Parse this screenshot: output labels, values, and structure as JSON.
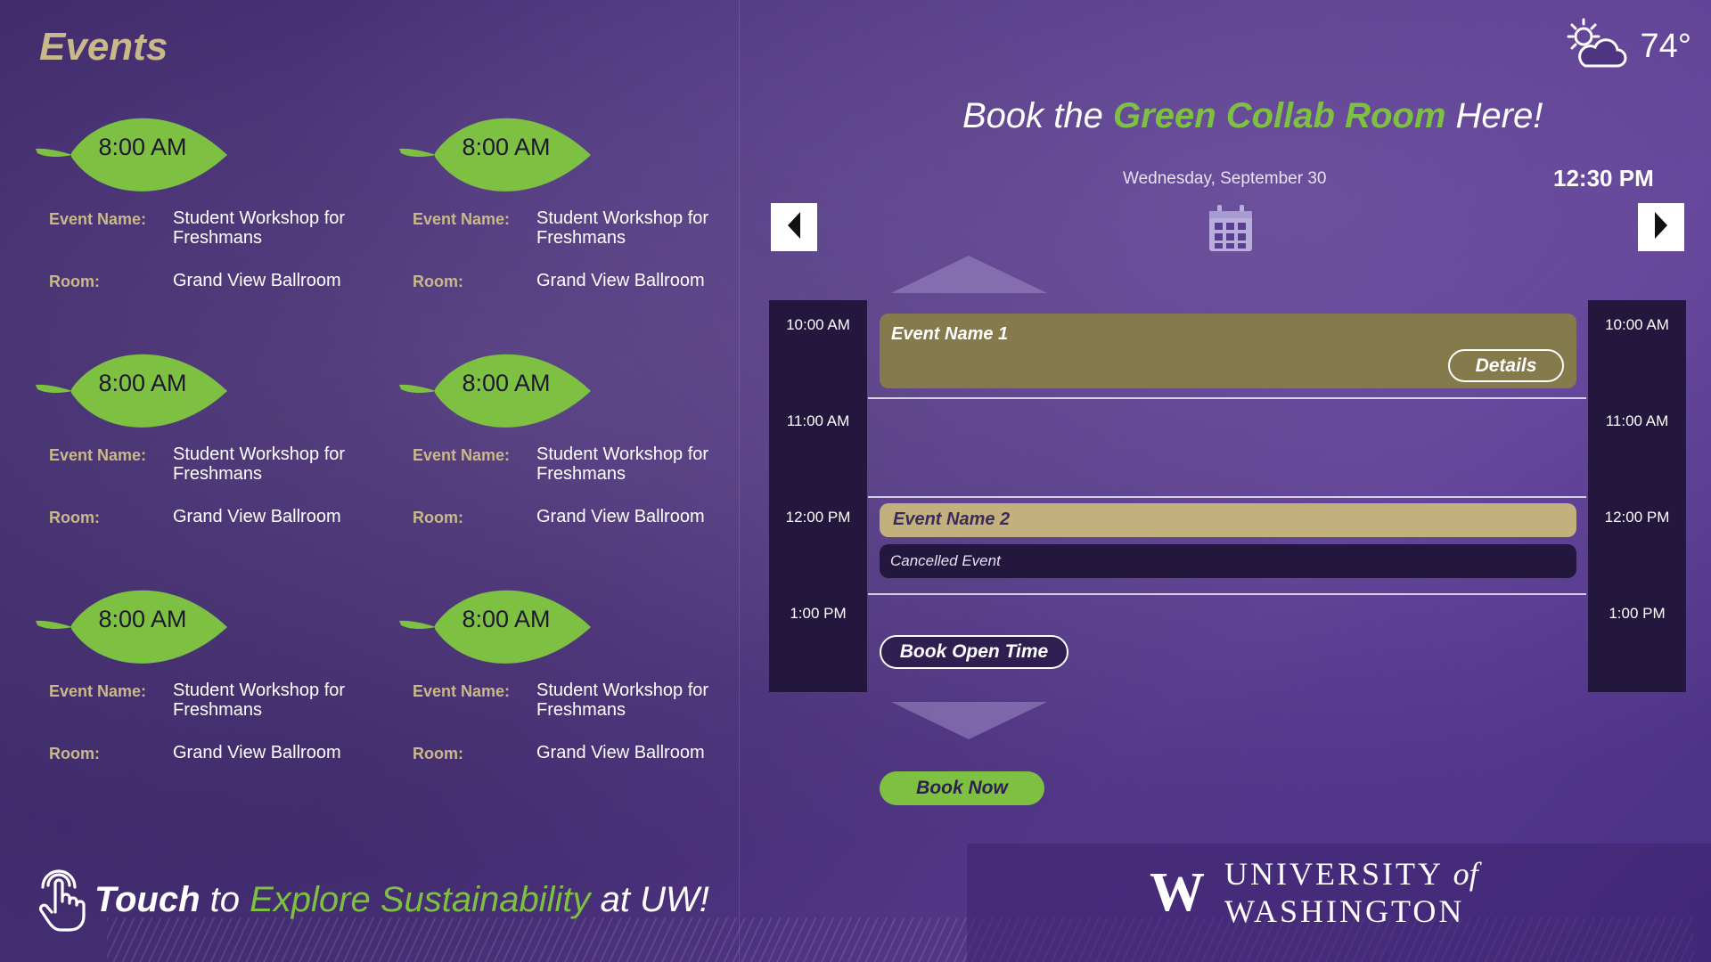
{
  "left_panel": {
    "title": "Events",
    "events": [
      {
        "time": "8:00 AM",
        "name_label": "Event Name:",
        "name": "Student Workshop for Freshmans",
        "room_label": "Room:",
        "room": "Grand View Ballroom"
      },
      {
        "time": "8:00 AM",
        "name_label": "Event Name:",
        "name": "Student Workshop for Freshmans",
        "room_label": "Room:",
        "room": "Grand View Ballroom"
      },
      {
        "time": "8:00 AM",
        "name_label": "Event Name:",
        "name": "Student Workshop for Freshmans",
        "room_label": "Room:",
        "room": "Grand View Ballroom"
      },
      {
        "time": "8:00 AM",
        "name_label": "Event Name:",
        "name": "Student Workshop for Freshmans",
        "room_label": "Room:",
        "room": "Grand View Ballroom"
      },
      {
        "time": "8:00 AM",
        "name_label": "Event Name:",
        "name": "Student Workshop for Freshmans",
        "room_label": "Room:",
        "room": "Grand View Ballroom"
      },
      {
        "time": "8:00 AM",
        "name_label": "Event Name:",
        "name": "Student Workshop for Freshmans",
        "room_label": "Room:",
        "room": "Grand View Ballroom"
      }
    ],
    "footer": {
      "touch": "Touch",
      "to": " to ",
      "explore": "Explore Sustainability",
      "at": " at UW!"
    }
  },
  "right_panel": {
    "weather": {
      "icon": "partly-cloudy-icon",
      "temperature": "74°"
    },
    "heading": {
      "prefix": "Book the ",
      "room": "Green Collab Room",
      "suffix": " Here!"
    },
    "date": "Wednesday, September 30",
    "current_time": "12:30 PM",
    "time_slots_left": [
      "10:00 AM",
      "11:00 AM",
      "12:00 PM",
      "1:00 PM"
    ],
    "time_slots_right": [
      "10:00 AM",
      "11:00 AM",
      "12:00 PM",
      "1:00 PM"
    ],
    "bookings": [
      {
        "name": "Event Name 1",
        "button": "Details"
      },
      {
        "name": "Event Name 2",
        "status": "Cancelled Event"
      }
    ],
    "open_time_button": "Book Open Time",
    "book_now_button": "Book Now",
    "logo": {
      "mark": "W",
      "text_1": "UNIVERSITY ",
      "text_of": "of",
      "text_2": " WASHINGTON"
    }
  },
  "colors": {
    "accent_green": "#7ec142",
    "gold": "#c9b98a",
    "booking_dark_gold": "#857a4b",
    "booking_light_gold": "#c2b17d",
    "timeline_dark": "#23173d"
  }
}
